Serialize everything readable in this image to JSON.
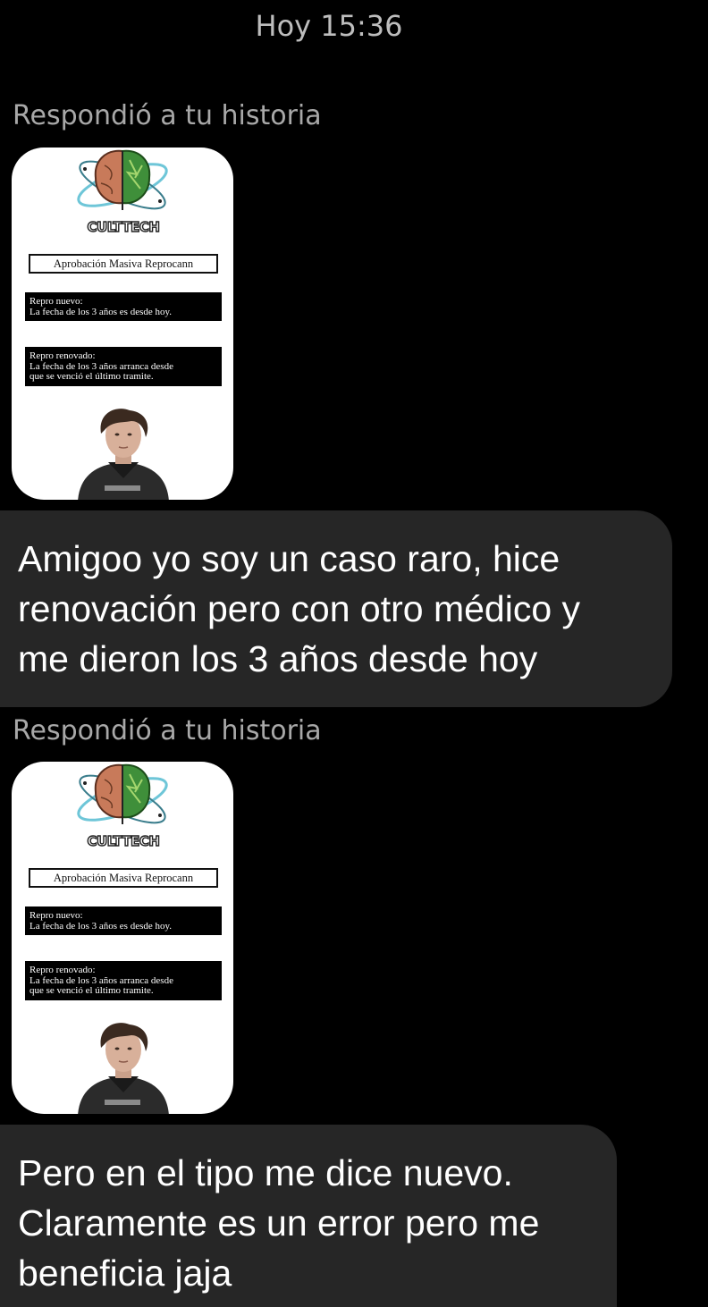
{
  "timestamp": "Hoy 15:36",
  "messages": [
    {
      "reply_label": "Respondió a tu historia",
      "story": {
        "brand": "CULTTECH",
        "heading": "Aprobación Masiva Reprocann",
        "box1": [
          "Repro nuevo:",
          "La fecha de los 3 años es desde hoy."
        ],
        "box2": [
          "Repro renovado:",
          "La fecha de los 3 años arranca desde",
          "que se venció el  último tramite."
        ]
      },
      "text_lines": [
        "Amigoo yo soy un caso raro, hice",
        "renovación pero con otro médico y",
        "me dieron los 3 años desde hoy"
      ]
    },
    {
      "reply_label": "Respondió a tu historia",
      "story": {
        "brand": "CULTTECH",
        "heading": "Aprobación Masiva Reprocann",
        "box1": [
          "Repro nuevo:",
          "La fecha de los 3 años es desde hoy."
        ],
        "box2": [
          "Repro renovado:",
          "La fecha de los 3 años arranca desde",
          "que se venció el  último tramite."
        ]
      },
      "text_lines": [
        "Pero en el tipo me dice nuevo.",
        "Claramente es un error pero me",
        "beneficia jaja"
      ]
    }
  ],
  "colors": {
    "background": "#000000",
    "bubble": "#262626",
    "label": "#a8a8a8",
    "brain_left": "#c87a5a",
    "brain_right": "#3f8f3a",
    "orbit": "#6ec6d8"
  }
}
